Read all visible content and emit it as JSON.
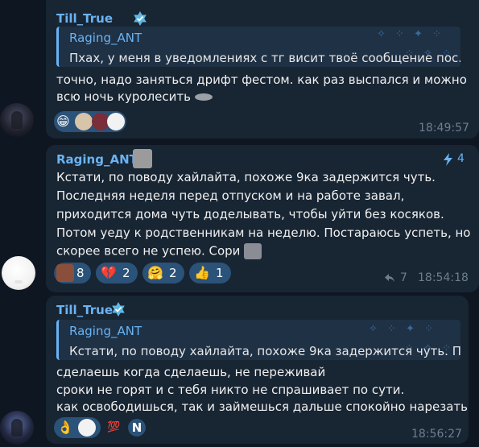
{
  "messages": [
    {
      "sender": "Till_True",
      "reply": {
        "name": "Raging_ANT",
        "text": "Пхах, у меня в уведомлениях с тг висит твоё сообщение пос..."
      },
      "lines": [
        "точно, надо заняться дрифт фестом. как раз выспался и можно",
        "всю ночь куролесить"
      ],
      "time": "18:49:57",
      "reactions": [
        "😁",
        "👀",
        "❤️",
        "⚪"
      ]
    },
    {
      "sender": "Raging_ANT",
      "stat": "4",
      "lines": [
        "Кстати, по поводу хайлайта, похоже 9ка задержится чуть.",
        "Последняя неделя перед отпуском и на работе завал,",
        "приходится дома чуть доделывать, чтобы уйти без косяков.",
        "Потом уеду к родственникам на неделю. Постараюсь успеть, но",
        "скорее всего не успею. Сори"
      ],
      "forwards": "7",
      "time": "18:54:18",
      "reactions": [
        {
          "emoji": "🖼️",
          "count": "8"
        },
        {
          "emoji": "💔",
          "count": "2"
        },
        {
          "emoji": "🤗",
          "count": "2"
        },
        {
          "emoji": "👍",
          "count": "1"
        }
      ]
    },
    {
      "sender": "Till_True",
      "reply": {
        "name": "Raging_ANT",
        "text": "Кстати, по поводу хайлайта, похоже 9ка задержится чуть. П..."
      },
      "lines": [
        "сделаешь когда сделаешь, не переживай",
        "сроки не горят и с тебя никто не спрашивает по сути.",
        "как освободишься, так и займешься дальше спокойно нарезать"
      ],
      "time": "18:56:27",
      "reactions": [
        "👌",
        "⚪",
        "💯",
        "N"
      ]
    }
  ],
  "colors": {
    "background": "#0e1621",
    "bubble": "#182533",
    "accent": "#6ab3f3",
    "reaction": "#2b5278",
    "timestamp": "#6d7f8f"
  }
}
